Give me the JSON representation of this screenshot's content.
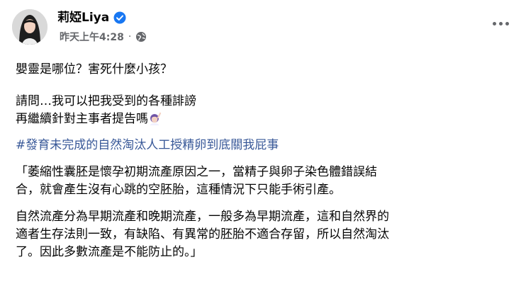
{
  "post": {
    "author_name": "莉婭Liya",
    "timestamp": "昨天上午4:28",
    "separator": "·",
    "icons": {
      "verified": "verified-badge-icon",
      "privacy": "globe-icon",
      "more": "more-options-icon",
      "emoji": "person-raising-hand-emoji"
    },
    "paragraphs": {
      "p1": "嬰靈是哪位？害死什麼小孩？",
      "p2_line1": "請問…我可以把我受到的各種誹謗",
      "p2_line2": "再繼續針對主事者提告嗎",
      "hashtag": "#發育未完成的自然淘汰人工授精卵到底關我屁事",
      "q1_line1": "「萎縮性囊胚是懷孕初期流產原因之一，當精子與卵子染色體錯誤結",
      "q1_line2": "合，就會產生沒有心跳的空胚胎，這種情況下只能手術引產。",
      "q2_line1": "自然流產分為早期流產和晚期流產，一般多為早期流產，這和自然界的",
      "q2_line2": "適者生存法則一致，有缺陷、有異常的胚胎不適合存留，所以自然淘汰",
      "q2_line3": "了。因此多數流產是不能防止的。」"
    }
  },
  "colors": {
    "text": "#050505",
    "meta": "#65676b",
    "hashtag": "#385898",
    "verified": "#1877f2"
  }
}
